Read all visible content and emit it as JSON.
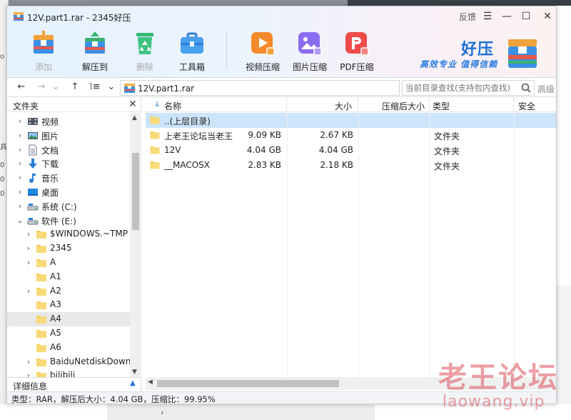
{
  "window": {
    "title": "12V.part1.rar - 2345好压",
    "feedback": "反馈",
    "menu_glyph": "☰",
    "minimize_glyph": "—",
    "maximize_glyph": "☐",
    "close_glyph": "✕"
  },
  "toolbar": {
    "buttons": [
      {
        "label": "添加",
        "icon": "add-archive-icon",
        "enabled": false
      },
      {
        "label": "解压到",
        "icon": "extract-to-icon",
        "enabled": true
      },
      {
        "label": "删除",
        "icon": "recycle-icon",
        "enabled": false
      },
      {
        "label": "工具箱",
        "icon": "toolbox-icon",
        "enabled": true
      },
      {
        "label": "视频压缩",
        "icon": "video-compress-icon",
        "enabled": true
      },
      {
        "label": "图片压缩",
        "icon": "image-compress-icon",
        "enabled": true
      },
      {
        "label": "PDF压缩",
        "icon": "pdf-compress-icon",
        "enabled": true
      }
    ]
  },
  "brand": {
    "name": "好压",
    "slogan": "高效专业 值得信赖"
  },
  "addressbar": {
    "back": "←",
    "forward": "→",
    "dropdown": "⌄",
    "up": "↑",
    "view": "⁞≡",
    "view_dropdown": "⌄",
    "path": "12V.part1.rar",
    "search_placeholder": "当前目录查找(支持包内查找)",
    "advanced": "高级"
  },
  "left_panel": {
    "title": "文件夹",
    "close": "✕",
    "tree": [
      {
        "label": "视频",
        "icon": "video-folder-icon",
        "chevron": "›",
        "level": 1
      },
      {
        "label": "图片",
        "icon": "pictures-folder-icon",
        "chevron": "›",
        "level": 1
      },
      {
        "label": "文档",
        "icon": "documents-folder-icon",
        "chevron": "›",
        "level": 1
      },
      {
        "label": "下载",
        "icon": "downloads-folder-icon",
        "chevron": "›",
        "level": 1
      },
      {
        "label": "音乐",
        "icon": "music-folder-icon",
        "chevron": "›",
        "level": 1
      },
      {
        "label": "桌面",
        "icon": "desktop-folder-icon",
        "chevron": "›",
        "level": 1
      },
      {
        "label": "系统 (C:)",
        "icon": "drive-icon",
        "chevron": "›",
        "level": 1
      },
      {
        "label": "软件 (E:)",
        "icon": "drive-icon",
        "chevron": "⌄",
        "level": 1
      },
      {
        "label": "$WINDOWS.~TMP",
        "icon": "folder-icon",
        "chevron": "›",
        "level": 2
      },
      {
        "label": "2345",
        "icon": "folder-icon",
        "chevron": "›",
        "level": 2
      },
      {
        "label": "A",
        "icon": "folder-icon",
        "chevron": "›",
        "level": 2
      },
      {
        "label": "A1",
        "icon": "folder-icon",
        "chevron": "",
        "level": 2
      },
      {
        "label": "A2",
        "icon": "folder-icon",
        "chevron": "›",
        "level": 2
      },
      {
        "label": "A3",
        "icon": "folder-icon",
        "chevron": "",
        "level": 2
      },
      {
        "label": "A4",
        "icon": "folder-icon",
        "chevron": "",
        "level": 2,
        "selected": true
      },
      {
        "label": "A5",
        "icon": "folder-icon",
        "chevron": "",
        "level": 2
      },
      {
        "label": "A6",
        "icon": "folder-icon",
        "chevron": "",
        "level": 2
      },
      {
        "label": "BaiduNetdiskDownl",
        "icon": "folder-icon",
        "chevron": "›",
        "level": 2
      },
      {
        "label": "bilibili",
        "icon": "folder-icon",
        "chevron": "›",
        "level": 2
      }
    ],
    "details_title": "详细信息",
    "details_toggle": "▲"
  },
  "file_list": {
    "columns": {
      "name": "名称",
      "size": "大小",
      "packed": "压缩后大小",
      "type": "类型",
      "security": "安全"
    },
    "sort_arrow": "↓",
    "rows": [
      {
        "name": "..(上层目录)",
        "size": "",
        "packed": "",
        "type": "",
        "selected": true
      },
      {
        "name": "上老王论坛当老王",
        "size": "9.09 KB",
        "packed": "2.67 KB",
        "type": "文件夹"
      },
      {
        "name": "12V",
        "size": "4.04 GB",
        "packed": "4.04 GB",
        "type": "文件夹"
      },
      {
        "name": "__MACOSX",
        "size": "2.83 KB",
        "packed": "2.18 KB",
        "type": "文件夹"
      }
    ]
  },
  "status": {
    "text": "类型：RAR，解压后大小：4.04 GB，压缩比：99.95%"
  },
  "watermark": {
    "line1": "老王论坛",
    "line2": "laowang.vip"
  },
  "background": {
    "left_fragments": [
      "o",
      "具",
      "0",
      "0",
      "0"
    ],
    "bottom_arrow": "›"
  },
  "colors": {
    "accent": "#1d6fd6",
    "selection": "#cce5fb",
    "folder": "#f7cf5e"
  }
}
